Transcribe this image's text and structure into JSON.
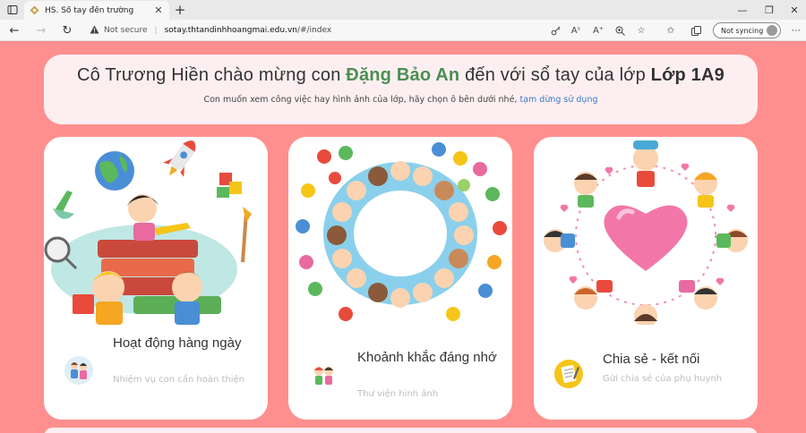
{
  "browser": {
    "tab_title": "HS. Sổ tay đến trường",
    "security_label": "Not secure",
    "url_host": "sotay.thtandinhhoangmai.edu.vn",
    "url_path": "/#/index",
    "sync_label": "Not syncing"
  },
  "welcome": {
    "prefix": "Cô Trương Hiền chào mừng con ",
    "student_name": "Đặng Bảo An",
    "middle": " đến với sổ tay của lớp ",
    "class_name": "Lớp 1A9",
    "subtitle": "Con muốn xem công việc hay hình ảnh của lớp, hãy chọn ô bên dưới nhé, ",
    "pause_link": "tạm dừng sử dụng"
  },
  "cards": [
    {
      "title": "Hoạt động hàng ngày",
      "subtitle": "Nhiệm vụ con cần hoàn thiện",
      "icon": "students-icon"
    },
    {
      "title": "Khoảnh khắc đáng nhớ",
      "subtitle": "Thư viện hình ảnh",
      "icon": "kids-photo-icon"
    },
    {
      "title": "Chia sẻ - kết nối",
      "subtitle": "Gửi chia sẻ của phụ huynh",
      "icon": "notepad-icon"
    }
  ],
  "colors": {
    "page_background": "#ff8f8f",
    "panel_background": "#fdeff1",
    "student_name": "#4a8f52",
    "link": "#3a78c8"
  }
}
